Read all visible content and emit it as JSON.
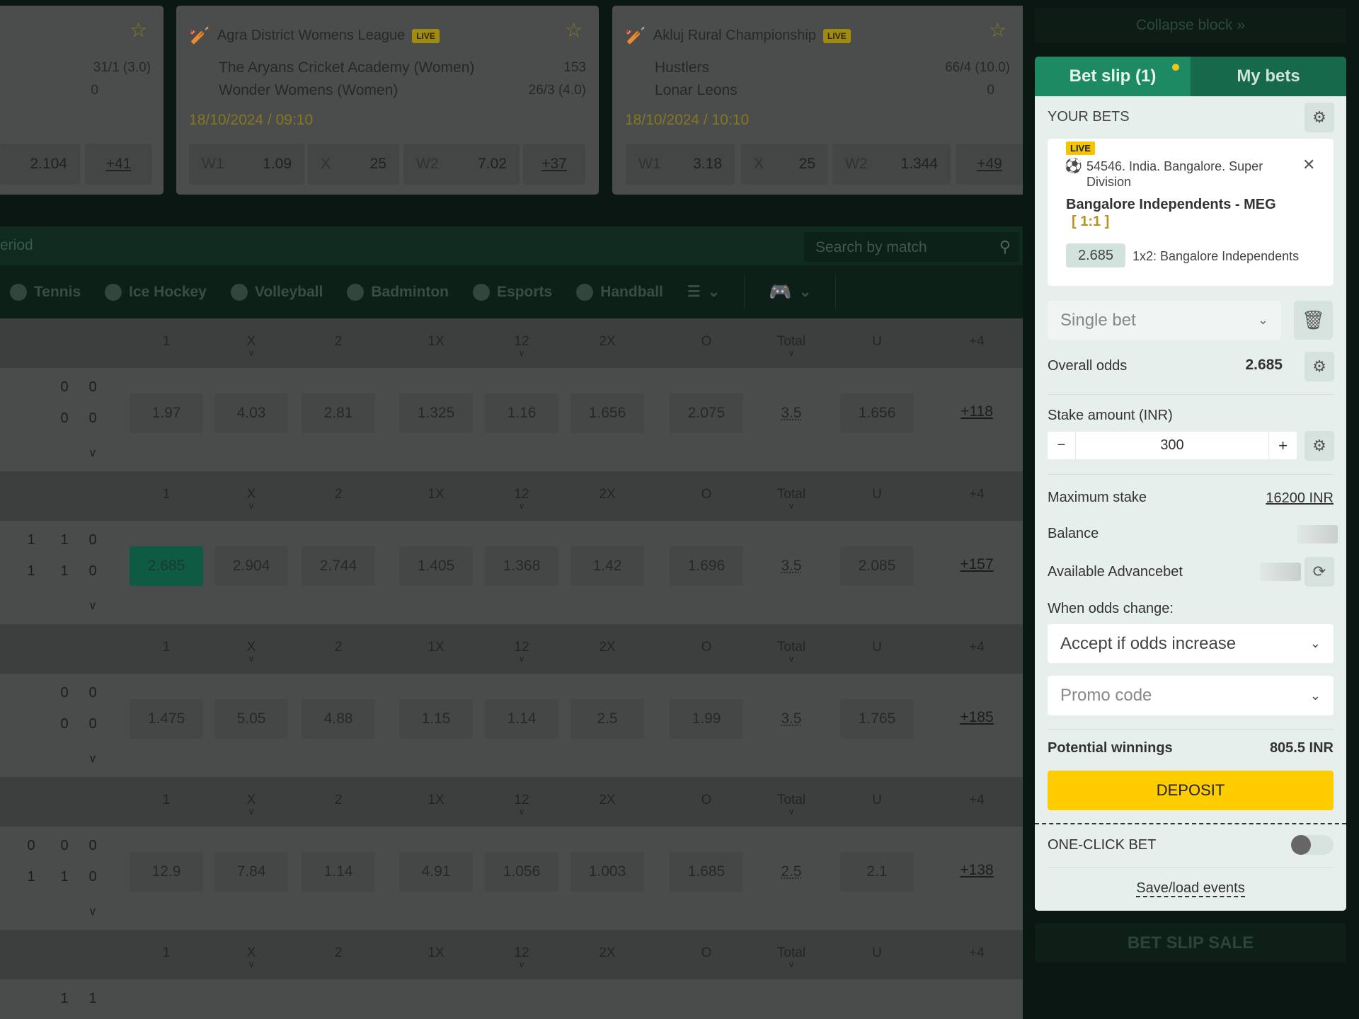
{
  "cards": [
    {
      "league": "",
      "live": "",
      "team1": "",
      "team2": "",
      "score1": "31/1 (3.0)",
      "score2": "0",
      "date": "",
      "odds": [
        {
          "k": "",
          "v": "2.104"
        }
      ],
      "more": "+41"
    },
    {
      "league": "Agra District Womens League",
      "live": "LIVE",
      "team1": "The Aryans Cricket Academy (Women)",
      "team2": "Wonder Womens (Women)",
      "score1": "153",
      "score2": "26/3 (4.0)",
      "date": "18/10/2024 / 09:10",
      "odds": [
        {
          "k": "W1",
          "v": "1.09"
        },
        {
          "k": "X",
          "v": "25"
        },
        {
          "k": "W2",
          "v": "7.02"
        }
      ],
      "more": "+37"
    },
    {
      "league": "Akluj Rural Championship",
      "live": "LIVE",
      "team1": "Hustlers",
      "team2": "Lonar Leons",
      "score1": "66/4 (10.0)",
      "score2": "0",
      "date": "18/10/2024 / 10:10",
      "odds": [
        {
          "k": "W1",
          "v": "3.18"
        },
        {
          "k": "X",
          "v": "25"
        },
        {
          "k": "W2",
          "v": "1.344"
        }
      ],
      "more": "+49"
    }
  ],
  "filter": {
    "period_label": "eriod",
    "search_placeholder": "Search by match"
  },
  "sports_nav": [
    "Tennis",
    "Ice Hockey",
    "Volleyball",
    "Badminton",
    "Esports",
    "Handball"
  ],
  "table": {
    "columns": [
      "1",
      "X",
      "2",
      "1X",
      "12",
      "2X",
      "O",
      "Total",
      "U",
      "+4"
    ],
    "rows": [
      {
        "scores": [
          [
            "",
            "0",
            "0"
          ],
          [
            "",
            "0",
            "0"
          ]
        ],
        "odds": [
          "1.97",
          "4.03",
          "2.81",
          "1.325",
          "1.16",
          "1.656",
          "2.075",
          "3.5",
          "1.656"
        ],
        "more": "+118"
      },
      {
        "scores": [
          [
            "1",
            "1",
            "0"
          ],
          [
            "1",
            "1",
            "0"
          ]
        ],
        "odds": [
          "2.685",
          "2.904",
          "2.744",
          "1.405",
          "1.368",
          "1.42",
          "1.696",
          "3.5",
          "2.085"
        ],
        "more": "+157",
        "selected": 0
      },
      {
        "scores": [
          [
            "",
            "0",
            "0"
          ],
          [
            "",
            "0",
            "0"
          ]
        ],
        "odds": [
          "1.475",
          "5.05",
          "4.88",
          "1.15",
          "1.14",
          "2.5",
          "1.99",
          "3.5",
          "1.765"
        ],
        "more": "+185"
      },
      {
        "scores": [
          [
            "0",
            "0",
            "0"
          ],
          [
            "1",
            "1",
            "0"
          ]
        ],
        "odds": [
          "12.9",
          "7.84",
          "1.14",
          "4.91",
          "1.056",
          "1.003",
          "1.685",
          "2.5",
          "2.1"
        ],
        "more": "+138"
      },
      {
        "scores": [
          [
            "",
            "1",
            "1"
          ]
        ],
        "odds": [],
        "more": ""
      }
    ]
  },
  "betslip": {
    "collapse": "Collapse block »",
    "tab_betslip": "Bet slip (1)",
    "tab_mybets": "My bets",
    "your_bets": "YOUR BETS",
    "bet": {
      "live": "LIVE",
      "event": "54546. India. Bangalore. Super Division",
      "match": "Bangalore Independents - MEG",
      "score": "[ 1:1 ]",
      "odds": "2.685",
      "market": "1x2: Bangalore Independents"
    },
    "bet_type": "Single bet",
    "overall_odds_label": "Overall odds",
    "overall_odds": "2.685",
    "stake_label": "Stake amount (INR)",
    "stake": "300",
    "minus": "−",
    "plus": "+",
    "max_stake_label": "Maximum stake",
    "max_stake": "16200 INR",
    "balance_label": "Balance",
    "advancebet_label": "Available Advancebet",
    "odds_change_label": "When odds change:",
    "odds_change": "Accept if odds increase",
    "promo": "Promo code",
    "winnings_label": "Potential winnings",
    "winnings": "805.5 INR",
    "deposit": "DEPOSIT",
    "one_click": "ONE-CLICK BET",
    "one_click_on": false,
    "save_load": "Save/load events",
    "sale": "BET SLIP SALE"
  },
  "colors": {
    "accent": "#1e8a63",
    "deposit": "#ffcc00",
    "live": "#f0c419"
  }
}
